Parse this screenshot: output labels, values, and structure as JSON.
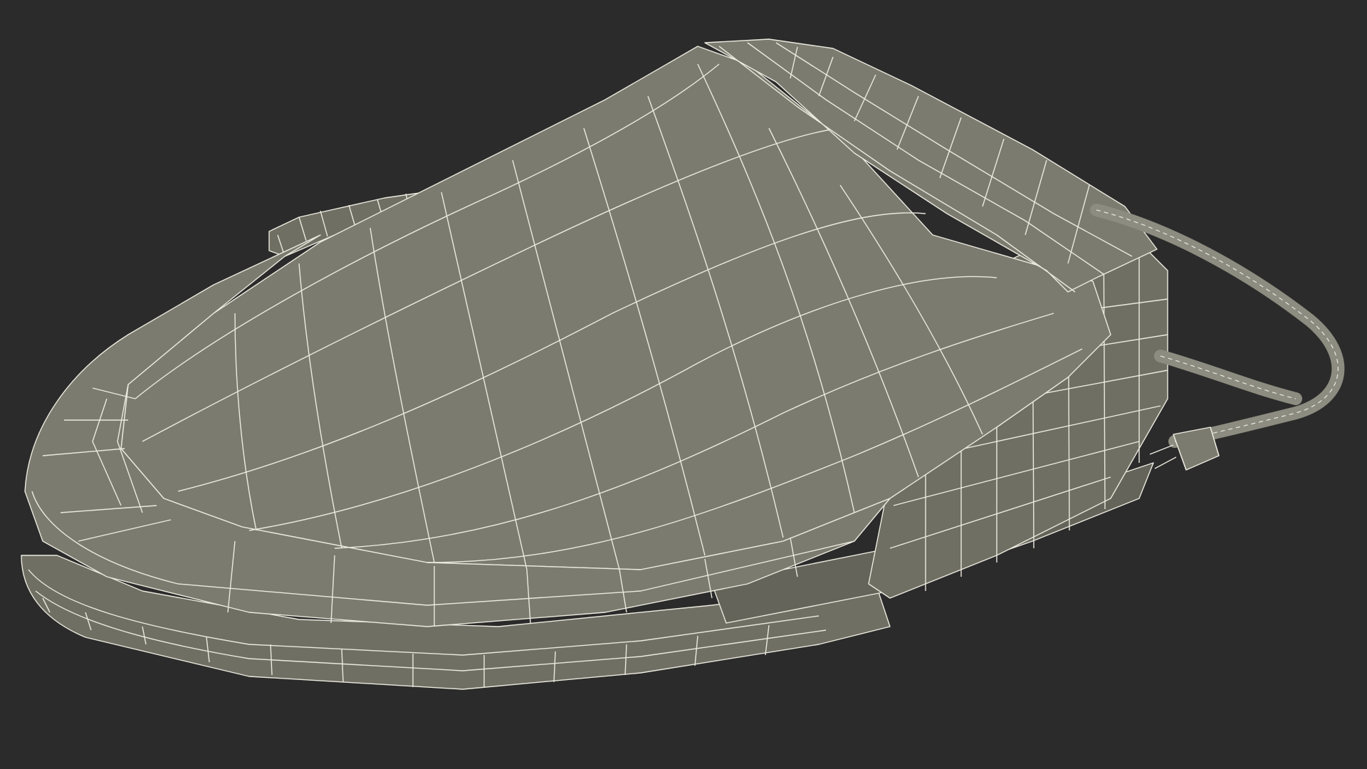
{
  "scene": {
    "subject": "wireframe-electronic-bidet-toilet-seat",
    "colors": {
      "background": "#2b2b2b",
      "surface": "#7b7b6f",
      "surface_dark": "#64645a",
      "side": "#6f6f64",
      "wire": "#eceadf",
      "cord": "#8c8c80"
    }
  }
}
